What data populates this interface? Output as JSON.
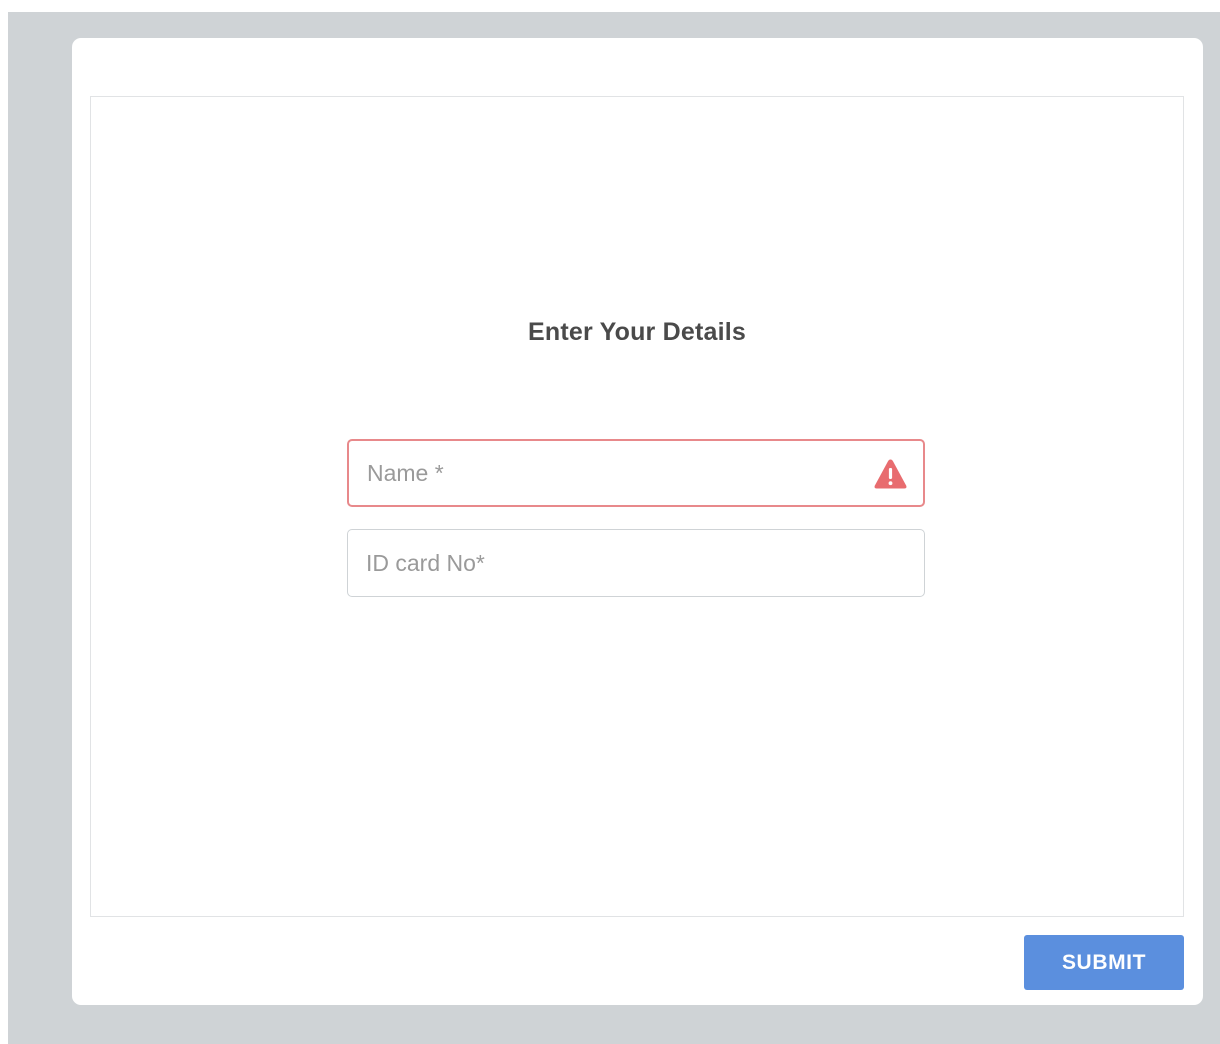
{
  "form": {
    "title": "Enter Your Details",
    "fields": [
      {
        "placeholder": "Name *",
        "value": "",
        "state": "error",
        "icon": "warning-icon"
      },
      {
        "placeholder": "ID card No*",
        "value": "",
        "state": "normal"
      }
    ],
    "submit_label": "SUBMIT"
  },
  "colors": {
    "backdrop": "#cfd3d6",
    "error_border": "#e8898b",
    "warning_icon": "#e86c6f",
    "submit_button": "#5b8fde",
    "title_text": "#4a4a4a",
    "placeholder_text": "#9a9a9a"
  }
}
